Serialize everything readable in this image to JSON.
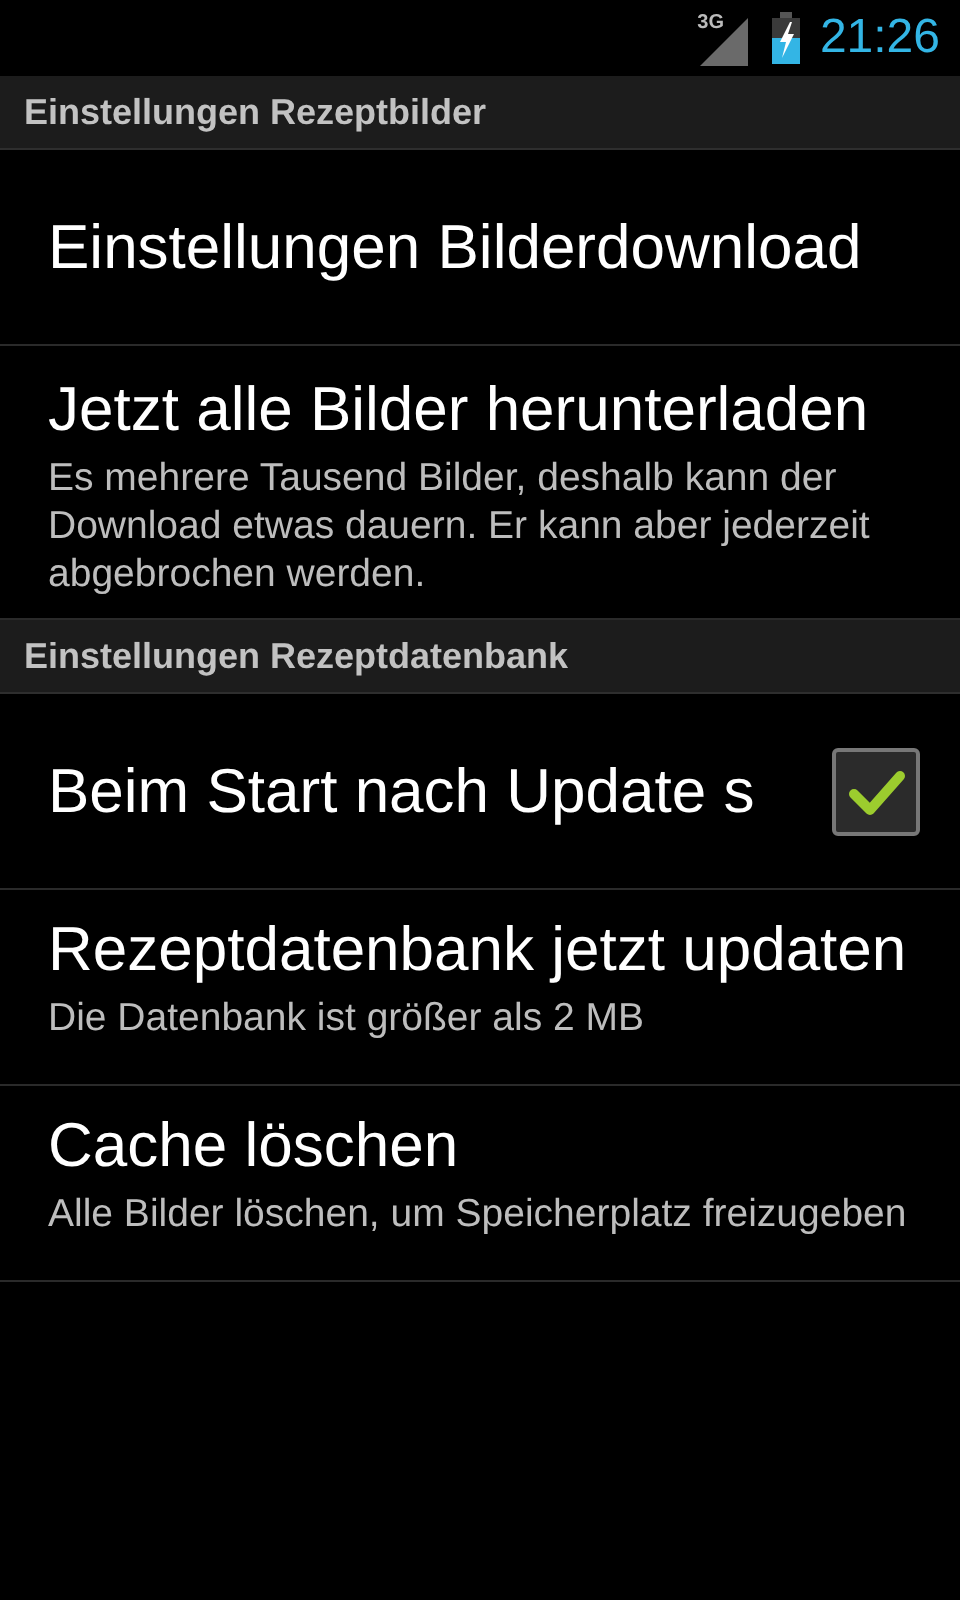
{
  "status_bar": {
    "network": "3G",
    "time": "21:26"
  },
  "sections": [
    {
      "title": "Einstellungen Rezeptbilder",
      "items": [
        {
          "kind": "plain",
          "title": "Einstellungen Bilderdownload"
        },
        {
          "kind": "plain",
          "title": "Jetzt alle Bilder herunterladen",
          "summary": "Es mehrere Tausend Bilder, deshalb kann der Download etwas dauern. Er kann aber jederzeit abgebrochen werden."
        }
      ]
    },
    {
      "title": "Einstellungen Rezeptdatenbank",
      "items": [
        {
          "kind": "checkbox",
          "title": "Beim Start nach Update s",
          "checked": true
        },
        {
          "kind": "plain",
          "title": "Rezeptdatenbank jetzt updaten",
          "summary": "Die Datenbank ist größer als 2 MB"
        },
        {
          "kind": "plain",
          "title": "Cache löschen",
          "summary": "Alle Bilder löschen, um Speicherplatz freizugeben"
        }
      ]
    }
  ]
}
